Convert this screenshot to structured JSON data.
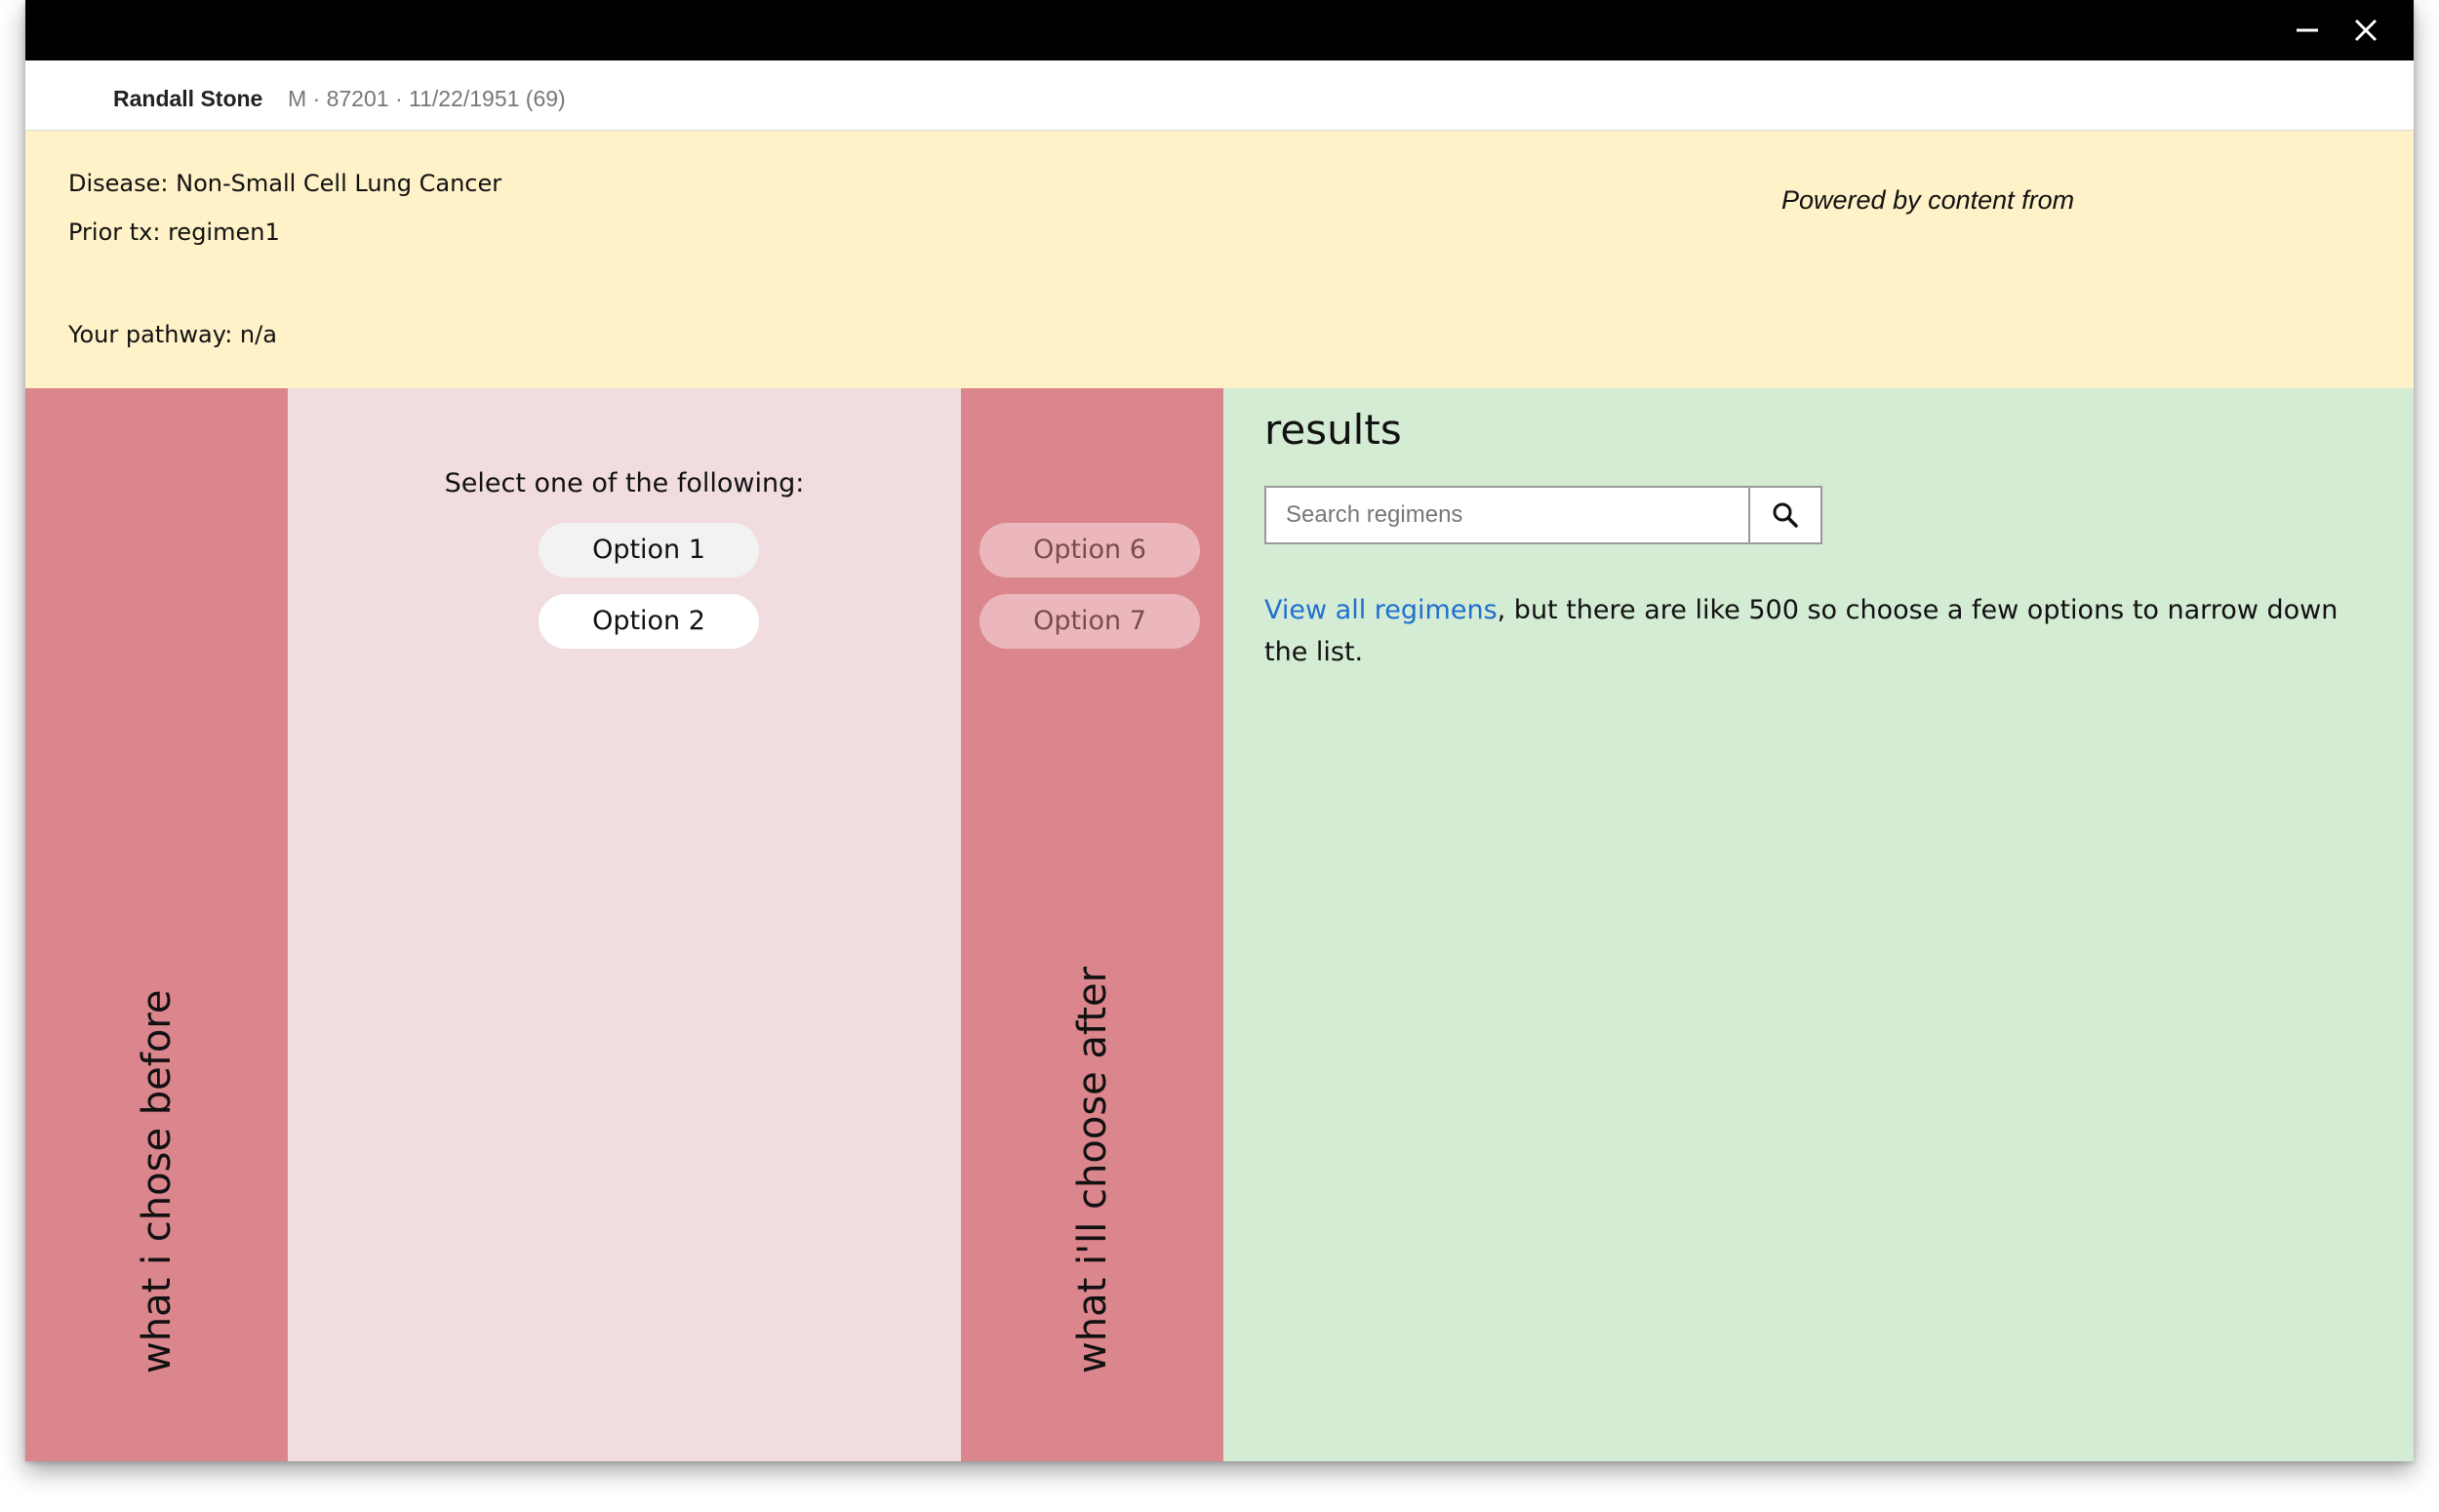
{
  "window": {
    "controls": {
      "minimize_icon": "minimize-icon",
      "close_icon": "close-icon"
    }
  },
  "patient": {
    "name": "Randall Stone",
    "meta": "M · 87201 · 11/22/1951 (69)"
  },
  "info": {
    "disease": "Disease: Non-Small Cell Lung Cancer",
    "prior_tx": "Prior tx: regimen1",
    "pathway": "Your pathway: n/a",
    "powered_by": "Powered by content from"
  },
  "columns": {
    "before_label": "what i chose before",
    "after_label": "what i'll choose after"
  },
  "selection": {
    "prompt": "Select one of the following:",
    "options": [
      "Option 1",
      "Option 2"
    ],
    "future_options": [
      "Option 6",
      "Option 7"
    ]
  },
  "results": {
    "title": "results",
    "search_placeholder": "Search regimens",
    "search_icon": "search-icon",
    "link_text": "View all regimens",
    "description": ", but there are like 500 so choose a few options to narrow down the list."
  },
  "colors": {
    "title_bar": "#000000",
    "info_panel": "#fff1c8",
    "side_column": "#db858c",
    "select_column": "#f1dde0",
    "results_column": "#d4ebd4",
    "link": "#1f6fd1"
  }
}
